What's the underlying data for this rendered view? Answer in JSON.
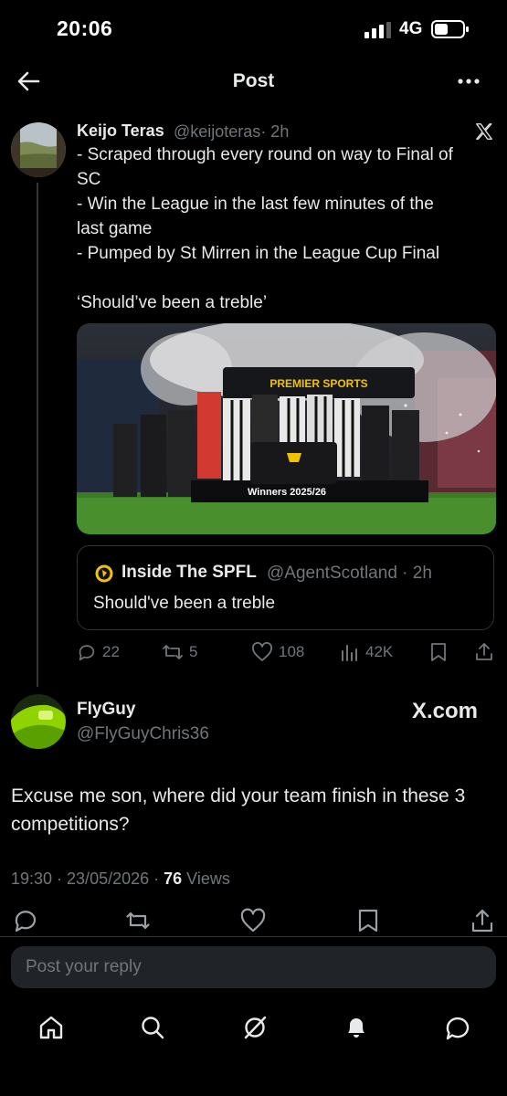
{
  "status": {
    "time": "20:06",
    "network": "4G"
  },
  "header": {
    "title": "Post"
  },
  "tweet1": {
    "name": "Keijo Teras",
    "handle": "@keijoteras",
    "time": "· 2h",
    "lines": [
      "- Scraped through every round on way to Final of",
      "SC",
      "- Win the League in the last few minutes of the",
      "last game",
      "- Pumped by St Mirren in the League Cup Final",
      "‘Should’ve been a treble’"
    ],
    "photo": {
      "banner": "PREMIER SPORTS",
      "podium": "Winners 2025/26"
    },
    "quote": {
      "name": "Inside The SPFL",
      "handle": "@AgentScotland · 2h",
      "text": "Should've been a treble"
    },
    "actions": {
      "replies": "22",
      "reposts": "5",
      "likes": "108",
      "views": "42K"
    }
  },
  "tweet2": {
    "name": "FlyGuy",
    "handle": "@FlyGuyChris36",
    "source": "X.com",
    "text": "Excuse me son, where did your team finish in these 3 competitions?",
    "meta_time": "19:30 · 23/05/2026 · ",
    "meta_views_count": "76",
    "meta_views_label": " Views"
  },
  "reply": {
    "placeholder": "Post your reply"
  },
  "colors": {
    "background": "#000000",
    "text": "#e7e9ea",
    "muted": "#71767b",
    "divider": "#2f3336"
  },
  "icons": [
    "back-arrow-icon",
    "more-icon",
    "x-logo-icon",
    "reply-icon",
    "repost-icon",
    "like-icon",
    "views-icon",
    "bookmark-icon",
    "share-icon",
    "home-icon",
    "search-icon",
    "grok-icon",
    "notifications-icon",
    "messages-icon"
  ]
}
